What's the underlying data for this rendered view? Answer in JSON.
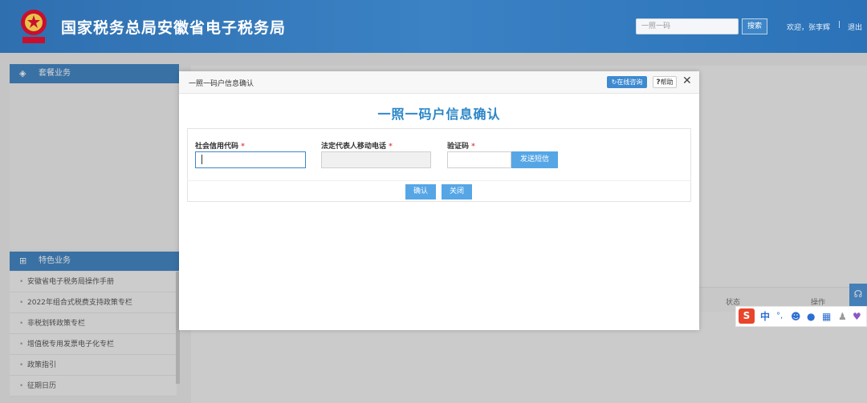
{
  "header": {
    "site_title": "国家税务总局安徽省电子税务局",
    "search_placeholder": "一照一码",
    "search_button": "搜索",
    "welcome": "欢迎，张李辉",
    "separator": "|",
    "logout": "退出",
    "colors": {
      "bar": "#2f6fb0"
    }
  },
  "sidebar": {
    "package_title": "套餐业务",
    "package_icon": "layers-icon",
    "special_title": "特色业务",
    "special_icon": "grid-icon",
    "items": [
      {
        "label": "安徽省电子税务局操作手册"
      },
      {
        "label": "2022年组合式税费支持政策专栏"
      },
      {
        "label": "非税划转政策专栏"
      },
      {
        "label": "增值税专用发票电子化专栏"
      },
      {
        "label": "政策指引"
      },
      {
        "label": "征期日历"
      }
    ]
  },
  "table": {
    "col_status": "状态",
    "col_operation": "操作"
  },
  "modal": {
    "title": "一照一码户信息确认",
    "online_button": "在线咨询",
    "help_button": "帮助",
    "heading": "一照一码户信息确认",
    "fields": {
      "credit_code_label": "社会信用代码",
      "phone_label": "法定代表人移动电话",
      "verify_label": "验证码",
      "required_mark": "*",
      "credit_code_value": "",
      "phone_value": "",
      "verify_value": ""
    },
    "sms_button": "发送短信",
    "confirm_button": "确认",
    "close_button": "关闭",
    "colors": {
      "heading": "#2a86c9",
      "button": "#56a6e6"
    }
  },
  "ime": {
    "logo": "S",
    "mode": "中",
    "punct": "°,"
  }
}
